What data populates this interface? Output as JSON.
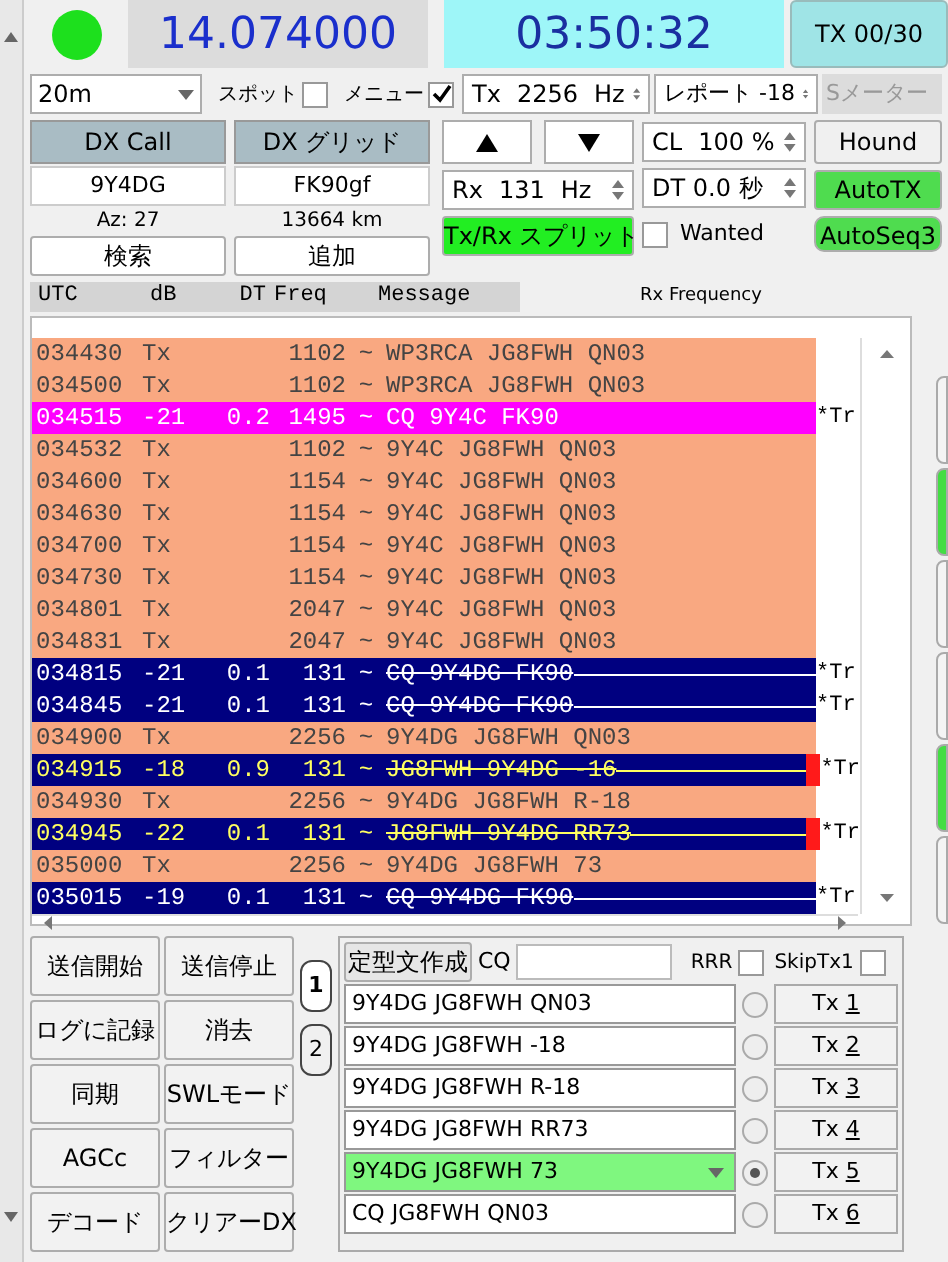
{
  "led": {
    "on": true
  },
  "frequency": "14.074000",
  "clock": "03:50:32",
  "tx_counter": "TX 00/30",
  "band": {
    "value": "20m"
  },
  "spot": {
    "label": "スポット",
    "checked": false
  },
  "menu": {
    "label": "メニュー",
    "checked": true
  },
  "tx_freq": {
    "label": "Tx",
    "value": "2256",
    "unit": "Hz"
  },
  "report": {
    "label": "レポート",
    "value": "-18"
  },
  "s_meter": {
    "label": "Sメーター",
    "disabled": true
  },
  "dx_call": {
    "label": "DX Call",
    "value": "9Y4DG",
    "info": "Az: 27",
    "button": "検索"
  },
  "dx_grid": {
    "label": "DX グリッド",
    "value": "FK90gf",
    "info": "13664 km",
    "button": "追加"
  },
  "cl": {
    "label": "CL",
    "value": "100",
    "unit": "%"
  },
  "hound": {
    "label": "Hound",
    "on": false
  },
  "rx_freq": {
    "label": "Rx",
    "value": "131",
    "unit": "Hz"
  },
  "dt": {
    "label": "DT",
    "value": "0.0",
    "unit": "秒"
  },
  "auto_tx": {
    "label": "AutoTX",
    "on": true
  },
  "split": {
    "label": "Tx/Rx スプリット",
    "on": true
  },
  "wanted": {
    "label": "Wanted",
    "checked": false
  },
  "auto_seq": {
    "label": "AutoSeq3",
    "on": true
  },
  "columns": [
    "UTC",
    "dB",
    "DT",
    "Freq",
    "Message"
  ],
  "rx_frequency_title": "Rx Frequency",
  "rows": [
    {
      "kind": "tx",
      "utc": "034430",
      "db": "Tx",
      "freq": "1102",
      "sep": "~",
      "message": "WP3RCA JG8FWH QN03"
    },
    {
      "kind": "tx",
      "utc": "034500",
      "db": "Tx",
      "freq": "1102",
      "sep": "~",
      "message": "WP3RCA JG8FWH QN03"
    },
    {
      "kind": "cq",
      "utc": "034515",
      "db": "-21",
      "dt": "0.2",
      "freq": "1495",
      "sep": "~",
      "message": "CQ 9Y4C FK90",
      "note": "*Tr"
    },
    {
      "kind": "tx",
      "utc": "034532",
      "db": "Tx",
      "freq": "1102",
      "sep": "~",
      "message": "9Y4C JG8FWH QN03"
    },
    {
      "kind": "tx",
      "utc": "034600",
      "db": "Tx",
      "freq": "1154",
      "sep": "~",
      "message": "9Y4C JG8FWH QN03"
    },
    {
      "kind": "tx",
      "utc": "034630",
      "db": "Tx",
      "freq": "1154",
      "sep": "~",
      "message": "9Y4C JG8FWH QN03"
    },
    {
      "kind": "tx",
      "utc": "034700",
      "db": "Tx",
      "freq": "1154",
      "sep": "~",
      "message": "9Y4C JG8FWH QN03"
    },
    {
      "kind": "tx",
      "utc": "034730",
      "db": "Tx",
      "freq": "1154",
      "sep": "~",
      "message": "9Y4C JG8FWH QN03"
    },
    {
      "kind": "tx",
      "utc": "034801",
      "db": "Tx",
      "freq": "2047",
      "sep": "~",
      "message": "9Y4C JG8FWH QN03"
    },
    {
      "kind": "tx",
      "utc": "034831",
      "db": "Tx",
      "freq": "2047",
      "sep": "~",
      "message": "9Y4C JG8FWH QN03"
    },
    {
      "kind": "decode",
      "utc": "034815",
      "db": "-21",
      "dt": "0.1",
      "freq": "131",
      "sep": "~",
      "message": "CQ 9Y4DG FK90",
      "note": "*Tr"
    },
    {
      "kind": "decode",
      "utc": "034845",
      "db": "-21",
      "dt": "0.1",
      "freq": "131",
      "sep": "~",
      "message": "CQ 9Y4DG FK90",
      "note": "*Tr"
    },
    {
      "kind": "tx",
      "utc": "034900",
      "db": "Tx",
      "freq": "2256",
      "sep": "~",
      "message": "9Y4DG JG8FWH QN03"
    },
    {
      "kind": "to_me",
      "utc": "034915",
      "db": "-18",
      "dt": "0.9",
      "freq": "131",
      "sep": "~",
      "message": "JG8FWH 9Y4DG -16",
      "note": "*Tr"
    },
    {
      "kind": "tx",
      "utc": "034930",
      "db": "Tx",
      "freq": "2256",
      "sep": "~",
      "message": "9Y4DG JG8FWH R-18"
    },
    {
      "kind": "to_me",
      "utc": "034945",
      "db": "-22",
      "dt": "0.1",
      "freq": "131",
      "sep": "~",
      "message": "JG8FWH 9Y4DG RR73",
      "note": "*Tr"
    },
    {
      "kind": "tx",
      "utc": "035000",
      "db": "Tx",
      "freq": "2256",
      "sep": "~",
      "message": "9Y4DG JG8FWH 73"
    },
    {
      "kind": "decode",
      "utc": "035015",
      "db": "-19",
      "dt": "0.1",
      "freq": "131",
      "sep": "~",
      "message": "CQ 9Y4DG FK90",
      "note": "*Tr"
    }
  ],
  "side_buttons": [
    {
      "on": false
    },
    {
      "on": true
    },
    {
      "on": false
    },
    {
      "on": false
    },
    {
      "on": true
    },
    {
      "on": false
    }
  ],
  "buttons": [
    [
      "送信開始",
      "送信停止"
    ],
    [
      "ログに記録",
      "消去"
    ],
    [
      "同期",
      "SWLモード"
    ],
    [
      "AGCc",
      "フィルター"
    ],
    [
      "デコード",
      "クリアーDX"
    ]
  ],
  "tabs": [
    {
      "label": "1",
      "selected": true
    },
    {
      "label": "2",
      "selected": false
    }
  ],
  "generate": {
    "label": "定型文作成"
  },
  "cq_label": "CQ",
  "rrr": {
    "label": "RRR",
    "checked": false
  },
  "skip_tx1": {
    "label": "SkipTx1",
    "checked": false
  },
  "messages": [
    {
      "kind": "field",
      "text": "9Y4DG JG8FWH QN03",
      "selected": false,
      "button": "Tx",
      "key": "1"
    },
    {
      "kind": "field",
      "text": "9Y4DG JG8FWH -18",
      "selected": false,
      "button": "Tx",
      "key": "2"
    },
    {
      "kind": "field",
      "text": "9Y4DG JG8FWH R-18",
      "selected": false,
      "button": "Tx",
      "key": "3"
    },
    {
      "kind": "field",
      "text": "9Y4DG JG8FWH RR73",
      "selected": false,
      "button": "Tx",
      "key": "4"
    },
    {
      "kind": "combo",
      "text": "9Y4DG JG8FWH 73",
      "selected": true,
      "button": "Tx",
      "key": "5"
    },
    {
      "kind": "field",
      "text": "CQ JG8FWH QN03",
      "selected": false,
      "button": "Tx",
      "key": "6"
    }
  ]
}
